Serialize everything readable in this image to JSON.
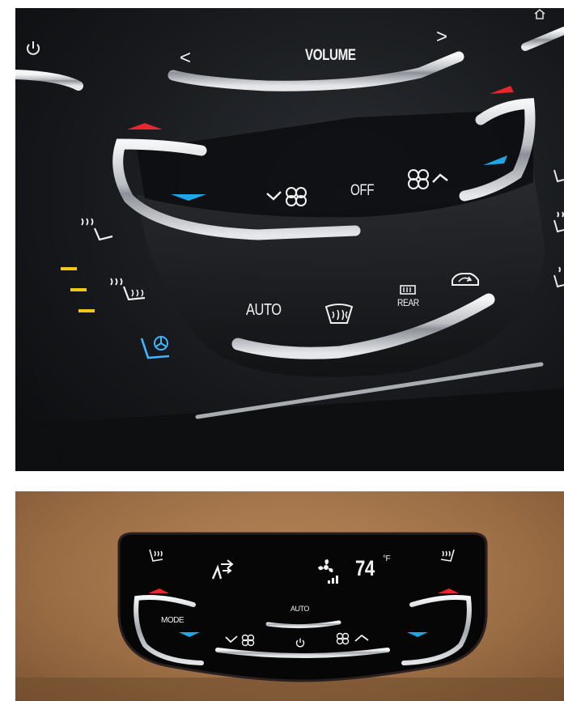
{
  "front_panel": {
    "volume_label": "VOLUME",
    "volume_down_glyph": "<",
    "volume_up_glyph": ">",
    "fan_off_label": "OFF",
    "auto_label": "AUTO",
    "rear_defrost_label": "REAR",
    "seat_heat_levels_active": 3,
    "colors": {
      "hot_indicator": "#e8262c",
      "cold_indicator": "#1fa6e8",
      "seat_heat_indicator": "#f5c518",
      "seat_cool_icon": "#3fb6ff"
    },
    "icons": [
      "power-icon",
      "home-icon",
      "seat-heat-icon",
      "seat-back-heat-icon",
      "seat-cool-icon",
      "fan-down-icon",
      "fan-up-icon",
      "front-defrost-icon",
      "rear-defrost-icon",
      "recirculation-icon"
    ]
  },
  "rear_panel": {
    "temperature_value": "74",
    "temperature_unit": "°F",
    "auto_label": "AUTO",
    "mode_label": "MODE",
    "icons": [
      "rear-seat-heat-left-icon",
      "rear-seat-heat-right-icon",
      "airflow-mode-icon",
      "fan-speed-icon",
      "rear-power-icon",
      "rear-fan-down-icon",
      "rear-fan-up-icon"
    ]
  }
}
